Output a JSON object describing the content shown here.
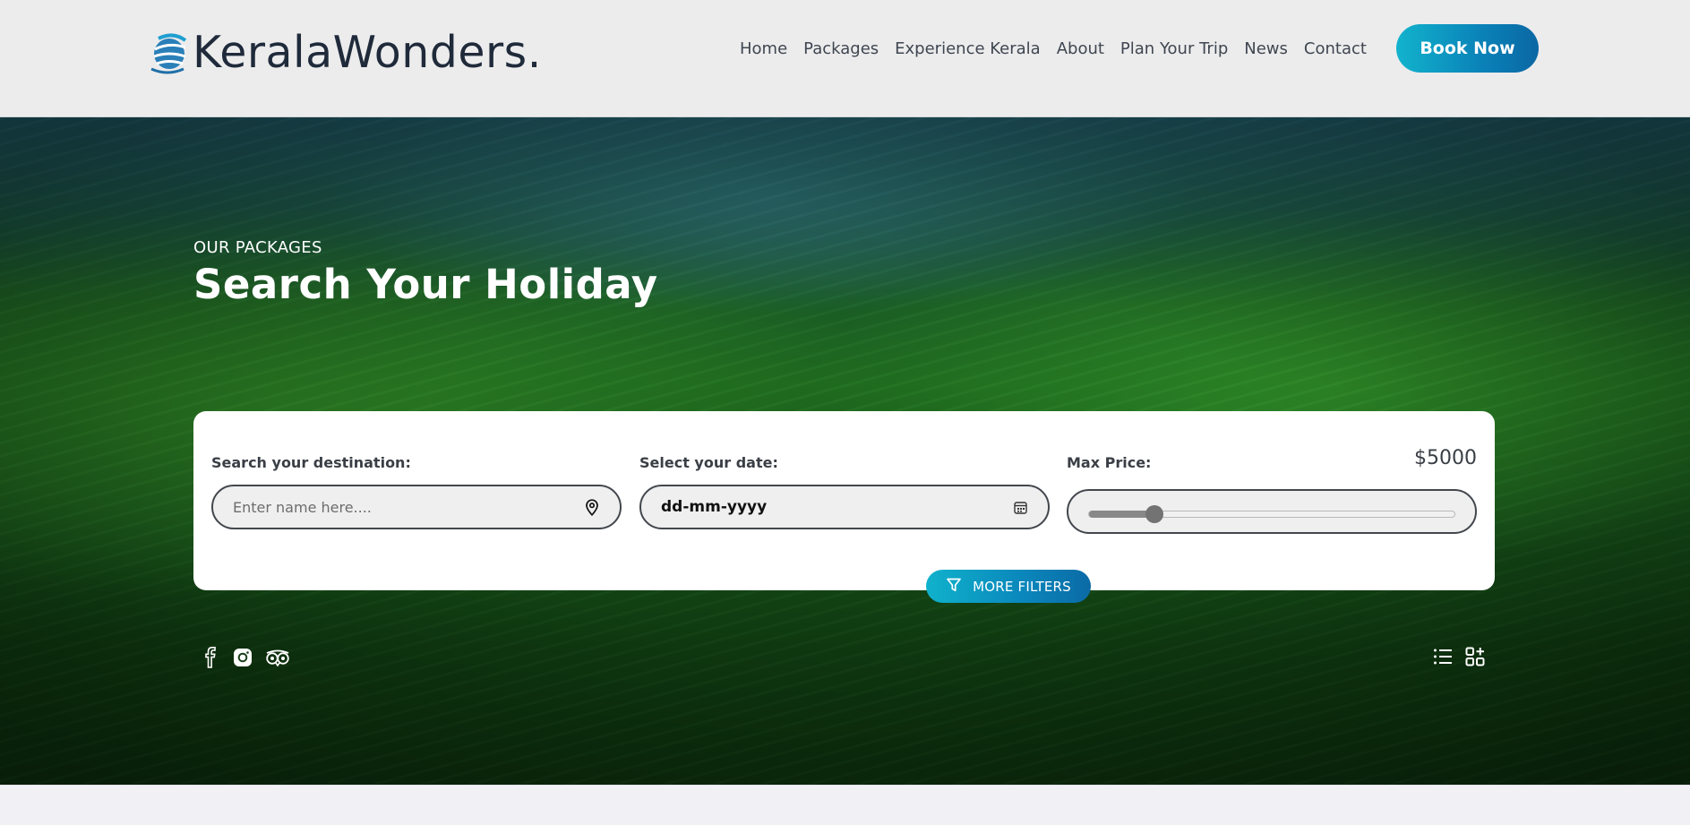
{
  "brand": {
    "name": "KeralaWonders."
  },
  "nav": {
    "items": [
      {
        "label": "Home"
      },
      {
        "label": "Packages"
      },
      {
        "label": "Experience Kerala"
      },
      {
        "label": "About"
      },
      {
        "label": "Plan Your Trip"
      },
      {
        "label": "News"
      },
      {
        "label": "Contact"
      }
    ],
    "cta_label": "Book Now"
  },
  "hero": {
    "pre_title": "OUR PACKAGES",
    "title_prefix": "Search Your ",
    "title_highlight": "Holiday"
  },
  "search": {
    "destination": {
      "label": "Search your destination:",
      "placeholder": "Enter name here....",
      "icon": "map-pin-icon"
    },
    "date": {
      "label": "Select your date:",
      "value": "dd-mm-yyyy",
      "icon": "calendar-icon"
    },
    "price": {
      "label": "Max Price:",
      "value_display": "$5000",
      "slider_fraction": 0.18
    },
    "more_filters_label": "MORE FILTERS",
    "more_filters_icon": "filter-icon"
  },
  "social": [
    "facebook-icon",
    "instagram-icon",
    "tripadvisor-icon"
  ],
  "view_toggles": [
    "list-view-icon",
    "grid-view-icon"
  ],
  "colors": {
    "accent": "#12b3cd",
    "accent_dark": "#0b67a3",
    "text_dark": "#1f2a3a"
  }
}
